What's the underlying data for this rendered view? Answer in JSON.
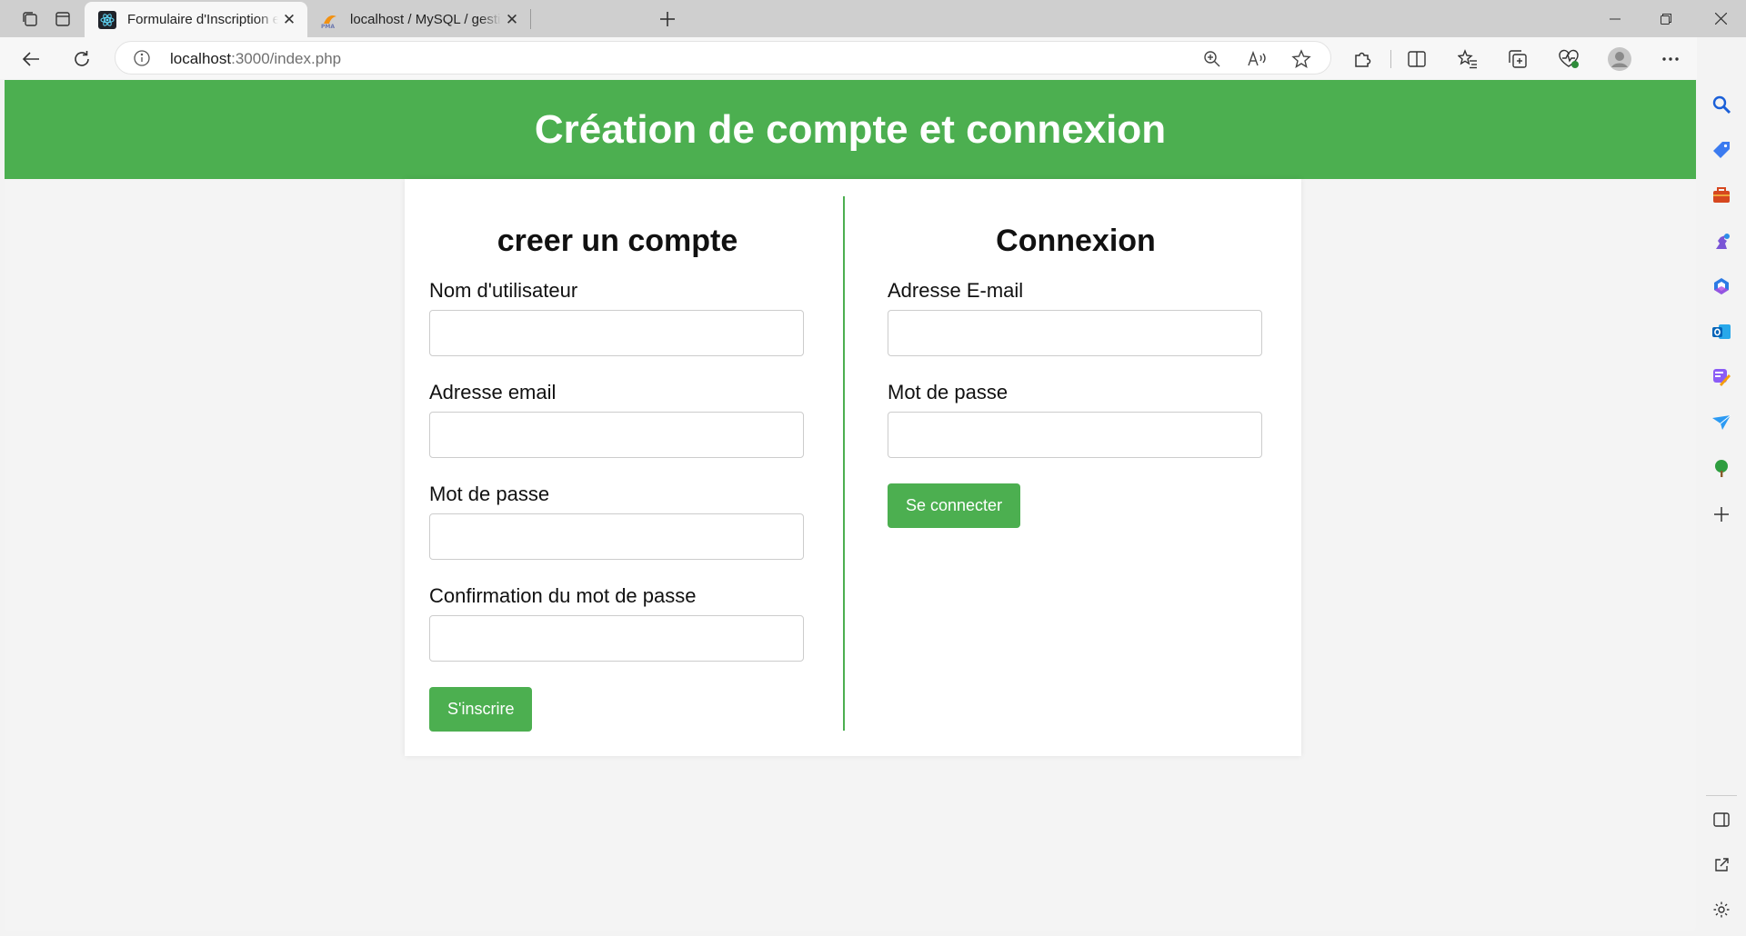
{
  "browser": {
    "tabs": [
      {
        "title": "Formulaire d'Inscription et de Connexion",
        "active": true,
        "icon": "react-icon"
      },
      {
        "title": "localhost / MySQL / gestionentreprise",
        "active": false,
        "icon": "phpmyadmin-icon"
      }
    ],
    "address": {
      "host": "localhost",
      "path": ":3000/index.php"
    }
  },
  "page": {
    "header_title": "Création de compte et connexion",
    "register": {
      "title": "creer un compte",
      "fields": [
        {
          "label": "Nom d'utilisateur",
          "value": ""
        },
        {
          "label": "Adresse email",
          "value": ""
        },
        {
          "label": "Mot de passe",
          "value": ""
        },
        {
          "label": "Confirmation du mot de passe",
          "value": ""
        }
      ],
      "submit_label": "S'inscrire"
    },
    "login": {
      "title": "Connexion",
      "fields": [
        {
          "label": "Adresse E-mail",
          "value": ""
        },
        {
          "label": "Mot de passe",
          "value": ""
        }
      ],
      "submit_label": "Se connecter"
    }
  },
  "colors": {
    "accent": "#4caf50",
    "background": "#f4f4f4",
    "card": "#ffffff"
  }
}
